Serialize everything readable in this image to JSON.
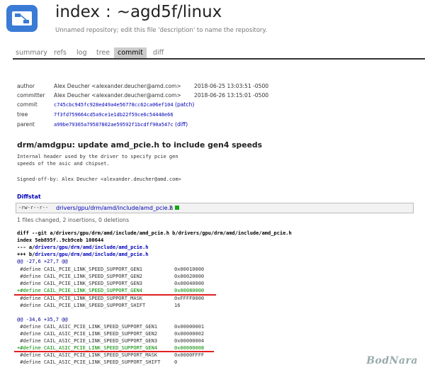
{
  "repo": {
    "name": "index",
    "separator": ":",
    "path": "~agd5f/linux",
    "description": "Unnamed repository; edit this file 'description' to name the repository."
  },
  "tabs": [
    {
      "label": "summary",
      "active": false
    },
    {
      "label": "refs",
      "active": false
    },
    {
      "label": "log",
      "active": false
    },
    {
      "label": "tree",
      "active": false
    },
    {
      "label": "commit",
      "active": true
    },
    {
      "label": "diff",
      "active": false
    }
  ],
  "commit_info": {
    "author": {
      "label": "author",
      "name": "Alex Deucher <alexander.deucher@amd.com>",
      "date": "2018-06-25 13:03:51 -0500"
    },
    "committer": {
      "label": "committer",
      "name": "Alex Deucher <alexander.deucher@amd.com>",
      "date": "2018-06-26 13:15:01 -0500"
    },
    "commit": {
      "label": "commit",
      "hash": "c745cbc945fc928ed49a4e56778cc62ca06ef104",
      "extra": "(patch)"
    },
    "tree": {
      "label": "tree",
      "hash": "7f3fd759664cd5a9ce1e1db22f59ce6c54448e66"
    },
    "parent": {
      "label": "parent",
      "hash": "a99be79365a79587802ae59592f1bcdff90a547c",
      "extra": "(diff)"
    }
  },
  "commit_subject": "drm/amdgpu: update amd_pcie.h to include gen4 speeds",
  "commit_message": [
    "Internal header used by the driver to specify pcie gen",
    "speeds of the asic and chipset.",
    "",
    "Signed-off-by: Alex Deucher <alexander.deucher@amd.com>"
  ],
  "diffstat": {
    "header": "Diffstat",
    "mode": "-rw-r--r--",
    "file": "drivers/gpu/drm/amd/include/amd_pcie.h",
    "count": "2",
    "bar_color": "#1a1",
    "summary": "1 files changed, 2 insertions, 0 deletions"
  },
  "diff": {
    "header": "diff --git a/drivers/gpu/drm/amd/include/amd_pcie.h b/drivers/gpu/drm/amd/include/amd_pcie.h",
    "index": "index 5eb895f..9cb9ceb 100644",
    "old_prefix": "--- a/",
    "new_prefix": "+++ b/",
    "file_path": "drivers/gpu/drm/amd/include/amd_pcie.h",
    "hunk1": {
      "header": "@@ -27,6 +27,7 @@",
      "lines": [
        {
          "prefix": " #define CAIL_PCIE_LINK_SPEED_SUPPORT_GEN1",
          "value": "0x00010000",
          "type": "ctx"
        },
        {
          "prefix": " #define CAIL_PCIE_LINK_SPEED_SUPPORT_GEN2",
          "value": "0x00020000",
          "type": "ctx"
        },
        {
          "prefix": " #define CAIL_PCIE_LINK_SPEED_SUPPORT_GEN3",
          "value": "0x00040000",
          "type": "ctx"
        },
        {
          "prefix": "+#define CAIL_PCIE_LINK_SPEED_SUPPORT_GEN4",
          "value": "0x00080000",
          "type": "add"
        },
        {
          "prefix": " #define CAIL_PCIE_LINK_SPEED_SUPPORT_MASK",
          "value": "0xFFFF0000",
          "type": "ctx"
        },
        {
          "prefix": " #define CAIL_PCIE_LINK_SPEED_SUPPORT_SHIFT",
          "value": "16",
          "type": "ctx"
        }
      ]
    },
    "hunk2": {
      "header": "@@ -34,6 +35,7 @@",
      "lines": [
        {
          "prefix": " #define CAIL_ASIC_PCIE_LINK_SPEED_SUPPORT_GEN1",
          "value": "0x00000001",
          "type": "ctx"
        },
        {
          "prefix": " #define CAIL_ASIC_PCIE_LINK_SPEED_SUPPORT_GEN2",
          "value": "0x00000002",
          "type": "ctx"
        },
        {
          "prefix": " #define CAIL_ASIC_PCIE_LINK_SPEED_SUPPORT_GEN3",
          "value": "0x00000004",
          "type": "ctx"
        },
        {
          "prefix": "+#define CAIL_ASIC_PCIE_LINK_SPEED_SUPPORT_GEN4",
          "value": "0x00000008",
          "type": "add"
        },
        {
          "prefix": " #define CAIL_ASIC_PCIE_LINK_SPEED_SUPPORT_MASK",
          "value": "0x0000FFFF",
          "type": "ctx"
        },
        {
          "prefix": " #define CAIL_ASIC_PCIE_LINK_SPEED_SUPPORT_SHIFT",
          "value": "0",
          "type": "ctx"
        }
      ]
    }
  },
  "annotation": {
    "underline_color": "#e02020"
  },
  "watermark": "BodNara"
}
